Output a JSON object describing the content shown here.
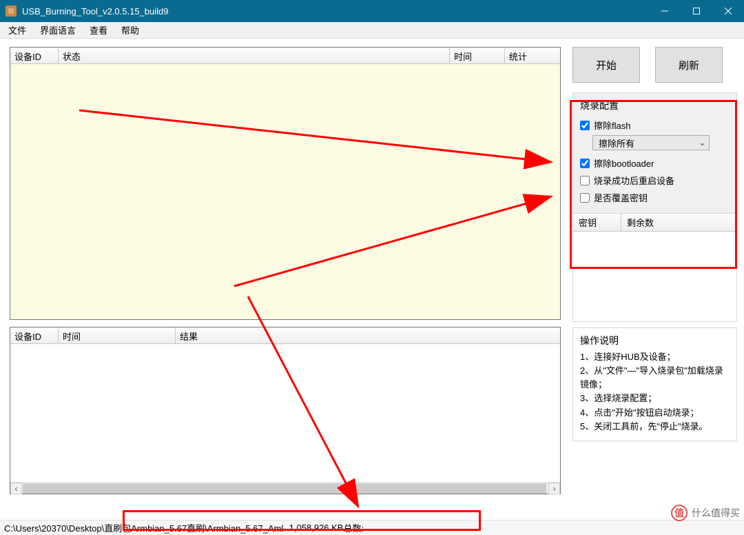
{
  "window": {
    "title": "USB_Burning_Tool_v2.0.5.15_build9"
  },
  "menu": {
    "file": "文件",
    "ui_lang": "界面语言",
    "view": "查看",
    "help": "帮助"
  },
  "dev_table": {
    "headers": {
      "id": "设备ID",
      "status": "状态",
      "time": "时间",
      "stats": "统计"
    }
  },
  "log_table": {
    "headers": {
      "id": "设备ID",
      "time": "时间",
      "result": "结果"
    }
  },
  "buttons": {
    "start": "开始",
    "refresh": "刷新"
  },
  "burn_config": {
    "title": "烧录配置",
    "erase_flash_label": "擦除flash",
    "erase_flash_checked": true,
    "erase_mode": "擦除所有",
    "erase_bootloader_label": "擦除bootloader",
    "erase_bootloader_checked": true,
    "reboot_after_label": "烧录成功后重启设备",
    "reboot_after_checked": false,
    "overwrite_key_label": "是否覆盖密钥",
    "overwrite_key_checked": false
  },
  "key_table": {
    "key_col": "密钥",
    "remain_col": "剩余数"
  },
  "ops": {
    "title": "操作说明",
    "l1": "1、连接好HUB及设备；",
    "l2": "2、从\"文件\"—\"导入烧录包\"加载烧录镜像；",
    "l3": "3、选择烧录配置；",
    "l4": "4、点击\"开始\"按钮启动烧录；",
    "l5": "5、关闭工具前，先\"停止\"烧录。"
  },
  "statusbar": {
    "path": "C:\\Users\\20370\\Desktop\\直刷包Armbian_5.67直刷\\Armbian_5.67_Aml-",
    "size": "1,058,926 KB",
    "total_label": "  总数:"
  },
  "watermark": {
    "text": "什么值得买"
  }
}
